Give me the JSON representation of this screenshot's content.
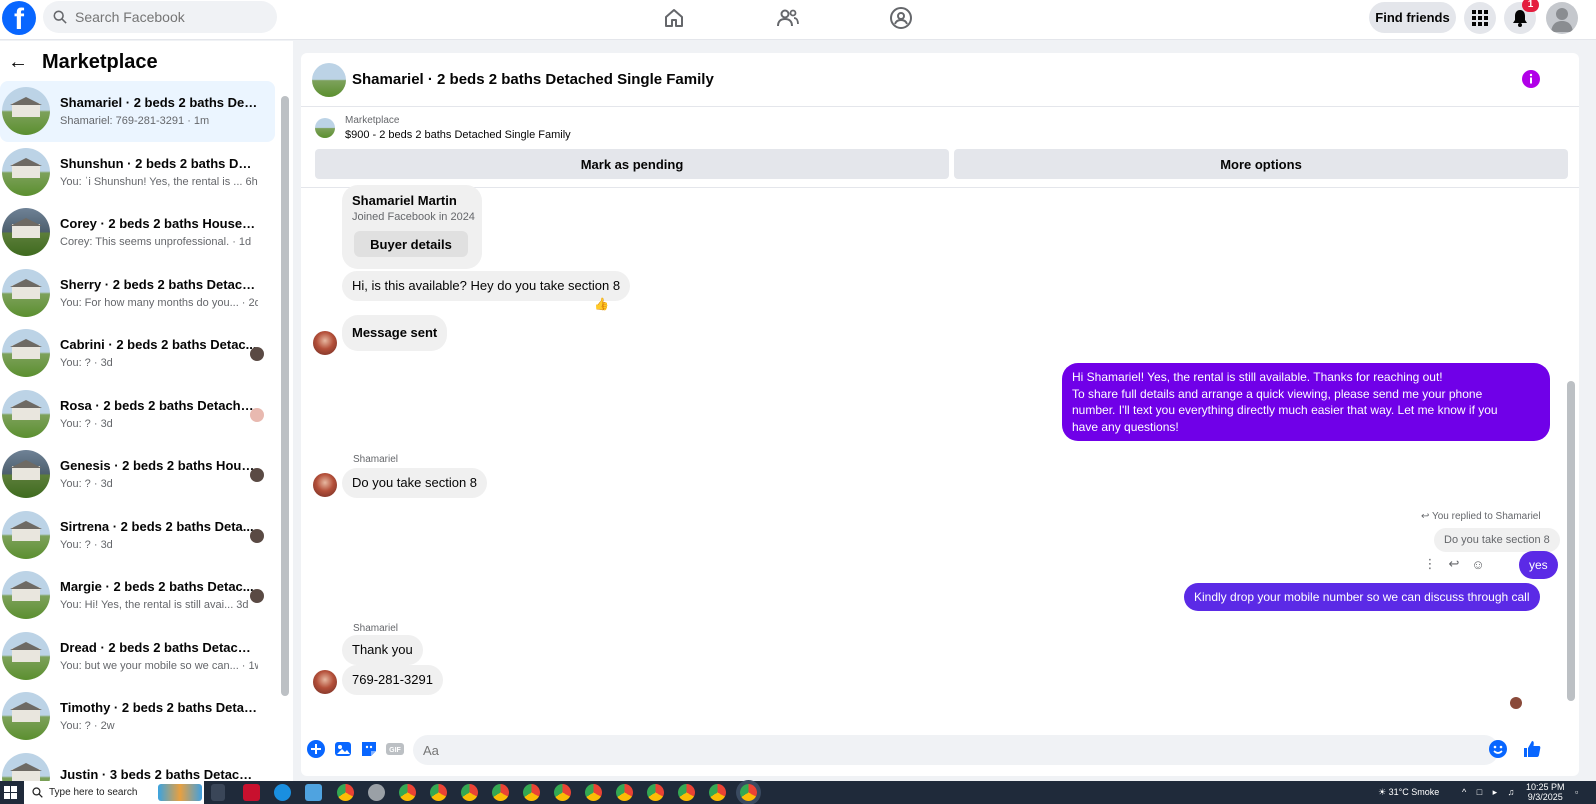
{
  "top_bar": {
    "logo": "f",
    "search_placeholder": "Search Facebook",
    "find_friends_label": "Find friends",
    "notification_count": "1",
    "nav_icons": [
      "home-icon",
      "friends-icon",
      "groups-icon"
    ]
  },
  "sidebar": {
    "title": "Marketplace",
    "conversations": [
      {
        "name": "Shamariel · 2 beds 2 baths Deta...",
        "preview": "Shamariel: 769-281-3291 · 1m",
        "active": true
      },
      {
        "name": "Shunshun · 2 beds 2 baths Deta...",
        "preview": "You: ˈi Shunshun! Yes, the rental is ... 6h"
      },
      {
        "name": "Corey · 2 beds 2 baths House fo...",
        "preview": "Corey: This seems unprofessional. · 1d"
      },
      {
        "name": "Sherry · 2 beds 2 baths Detache...",
        "preview": "You: For how many months do you... · 2d"
      },
      {
        "name": "Cabrini · 2 beds 2 baths Detac...",
        "preview": "You: ? · 3d"
      },
      {
        "name": "Rosa · 2 beds 2 baths Detache...",
        "preview": "You: ? · 3d"
      },
      {
        "name": "Genesis · 2 beds 2 baths Hous...",
        "preview": "You: ? · 3d"
      },
      {
        "name": "Sirtrena · 2 beds 2 baths Deta...",
        "preview": "You: ? · 3d"
      },
      {
        "name": "Margie · 2 beds 2 baths Detac...",
        "preview": "You: Hi! Yes, the rental is still avai... 3d"
      },
      {
        "name": "Dread · 2 beds 2 baths Detached...",
        "preview": "You: but we your mobile so we can... · 1w"
      },
      {
        "name": "Timothy · 2 beds 2 baths Detach...",
        "preview": "You: ? · 2w"
      },
      {
        "name": "Justin · 3 beds 2 baths Detached...",
        "preview": ""
      }
    ]
  },
  "chat": {
    "title": "Shamariel · 2 beds 2 baths Detached Single Family",
    "marketplace_label": "Marketplace",
    "listing": "$900 - 2 beds 2 baths Detached Single Family",
    "mark_pending_label": "Mark as pending",
    "more_options_label": "More options",
    "buyer_card": {
      "name": "Shamariel Martin",
      "joined": "Joined Facebook in 2024",
      "button": "Buyer details"
    },
    "messages": {
      "m1": "Hi, is this available? Hey do you take section 8",
      "m1_reaction": "👍",
      "m2": "Message sent",
      "m3_lines": [
        "Hi Shamariel! Yes, the rental is still available. Thanks for reaching out!",
        "To share full details and arrange a quick viewing, please send me your phone",
        "number. I'll text you everything directly much easier that way. Let me know if you",
        "have any questions!"
      ],
      "sender1": "Shamariel",
      "m4": "Do you take section 8",
      "reply_label": "You replied to Shamariel",
      "quoted": "Do you take section 8",
      "m5": "yes",
      "m6": "Kindly drop your mobile number so we can discuss through call",
      "sender2": "Shamariel",
      "m7": "Thank you",
      "m8": "769-281-3291"
    },
    "composer_placeholder": "Aa"
  },
  "taskbar": {
    "search_placeholder": "Type here to search",
    "weather": "31°C  Smoke",
    "time": "10:25 PM",
    "date": "9/3/2025"
  },
  "colors": {
    "brand": "#0866ff",
    "outgoing": "#7000e8",
    "outgoing_alt": "#5b2ae6",
    "info": "#b100e8"
  }
}
